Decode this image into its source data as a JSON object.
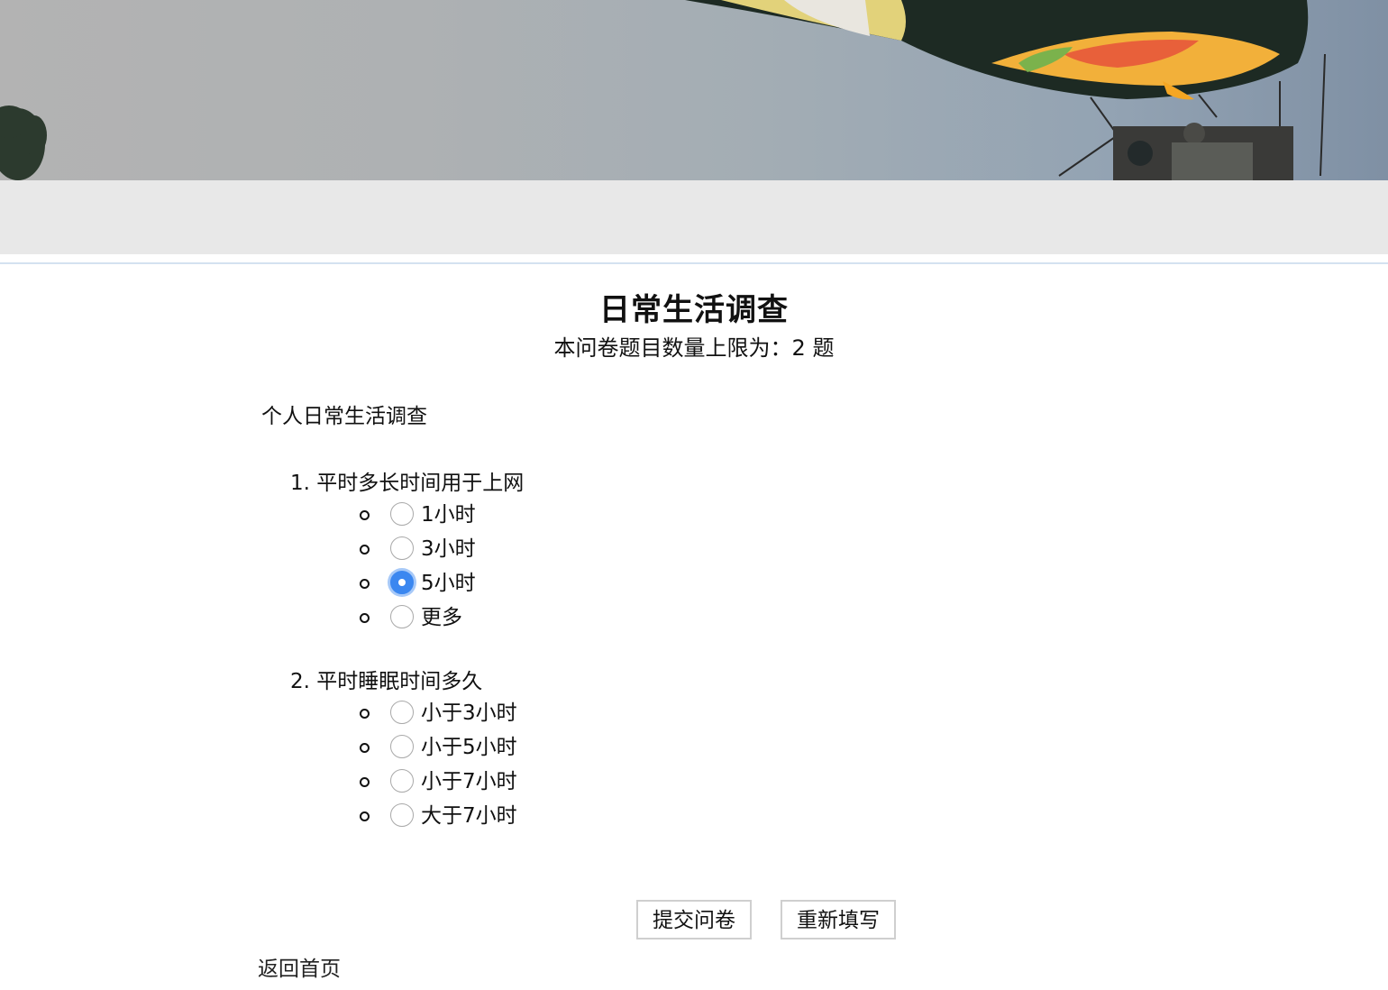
{
  "survey": {
    "title": "日常生活调查",
    "subtitle": "本问卷题目数量上限为：2 题",
    "description": "个人日常生活调查"
  },
  "questions": [
    {
      "title": "1. 平时多长时间用于上网",
      "options": [
        "1小时",
        "3小时",
        "5小时",
        "更多"
      ],
      "selected": 2
    },
    {
      "title": "2. 平时睡眠时间多久",
      "options": [
        "小于3小时",
        "小于5小时",
        "小于7小时",
        "大于7小时"
      ],
      "selected": null
    }
  ],
  "actions": {
    "submit_label": "提交问卷",
    "reset_label": "重新填写",
    "home_link": "返回首页"
  },
  "colors": {
    "radio_checked": "#3b87f0",
    "band_bg": "#e8e8e8"
  }
}
